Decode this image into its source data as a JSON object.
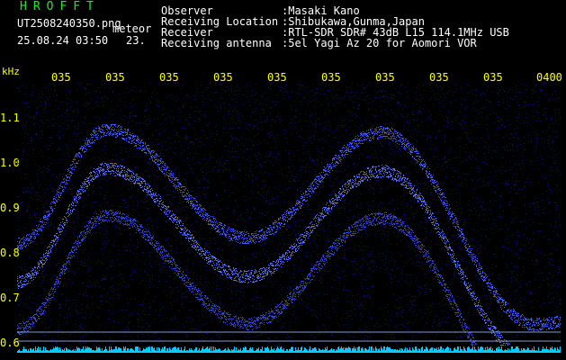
{
  "header": {
    "brand": "HROFFT",
    "filename": "UT2508240350.png",
    "mode": "meteor",
    "datetime": "25.08.24 03:50",
    "status": "23."
  },
  "info": {
    "rows": [
      {
        "label": "Observer",
        "value": ":Masaki Kano"
      },
      {
        "label": "Receiving Location",
        "value": ":Shibukawa,Gunma,Japan"
      },
      {
        "label": "Receiver",
        "value": ":RTL-SDR SDR# 43dB L15 114.1MHz USB"
      },
      {
        "label": "Receiving antenna",
        "value": ":5el Yagi Az 20 for Aomori VOR"
      }
    ]
  },
  "axis": {
    "unit": "kHz",
    "time_ticks": [
      "035",
      "035",
      "035",
      "035",
      "035",
      "035",
      "035",
      "035",
      "035",
      "0400"
    ],
    "freq_ticks": [
      "1.1",
      "1.0",
      "0.9",
      "0.8",
      "0.7",
      "0.6"
    ]
  },
  "colors": {
    "brand": "#22e822",
    "axis_labels": "#ffff00",
    "signal": "#3a5cff",
    "background": "#000000",
    "baseline": "#00ccff"
  }
}
